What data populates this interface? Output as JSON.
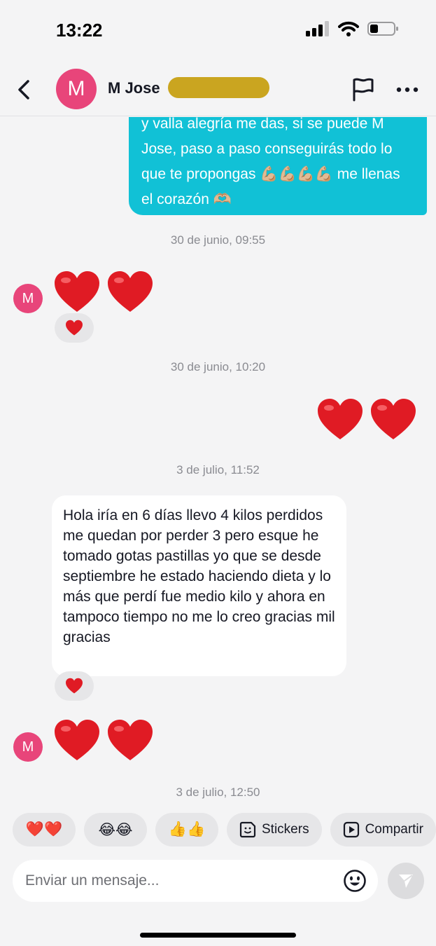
{
  "status_bar": {
    "time": "13:22"
  },
  "header": {
    "avatar_letter": "M",
    "contact_name": "M Jose"
  },
  "messages": {
    "outgoing_text": "y valla alegría me das, si se puede M Jose, paso a paso conseguirás todo lo que te propongas 💪🏼💪🏼💪🏼💪🏼 me llenas el corazón 🫶🏼",
    "ts1": "30 de junio, 09:55",
    "ts2": "30 de junio, 10:20",
    "ts3": "3 de julio, 11:52",
    "ts4": "3 de julio, 12:50",
    "incoming_text": "Hola iría en 6 días llevo 4 kilos perdidos me quedan por perder 3 pero esque he tomado gotas pastillas yo que se desde septiembre he estado haciendo dieta y lo más que perdí fue medio kilo y ahora en tampoco tiempo no me lo creo gracias mil gracias",
    "avatar_letter": "M"
  },
  "quick_replies": {
    "hearts": "❤️❤️",
    "laugh": "😂😂",
    "thumbs": "👍👍",
    "stickers": "Stickers",
    "share": "Compartir"
  },
  "composer": {
    "placeholder": "Enviar un mensaje..."
  },
  "colors": {
    "accent": "#11c1d6",
    "avatar": "#e8457a",
    "heart": "#e01b24",
    "background": "#f4f4f5"
  },
  "icons": [
    "back-icon",
    "flag-icon",
    "more-icon",
    "heart-icon",
    "sticker-icon",
    "share-play-icon",
    "emoji-icon",
    "send-icon",
    "signal-icon",
    "wifi-icon",
    "battery-icon"
  ]
}
